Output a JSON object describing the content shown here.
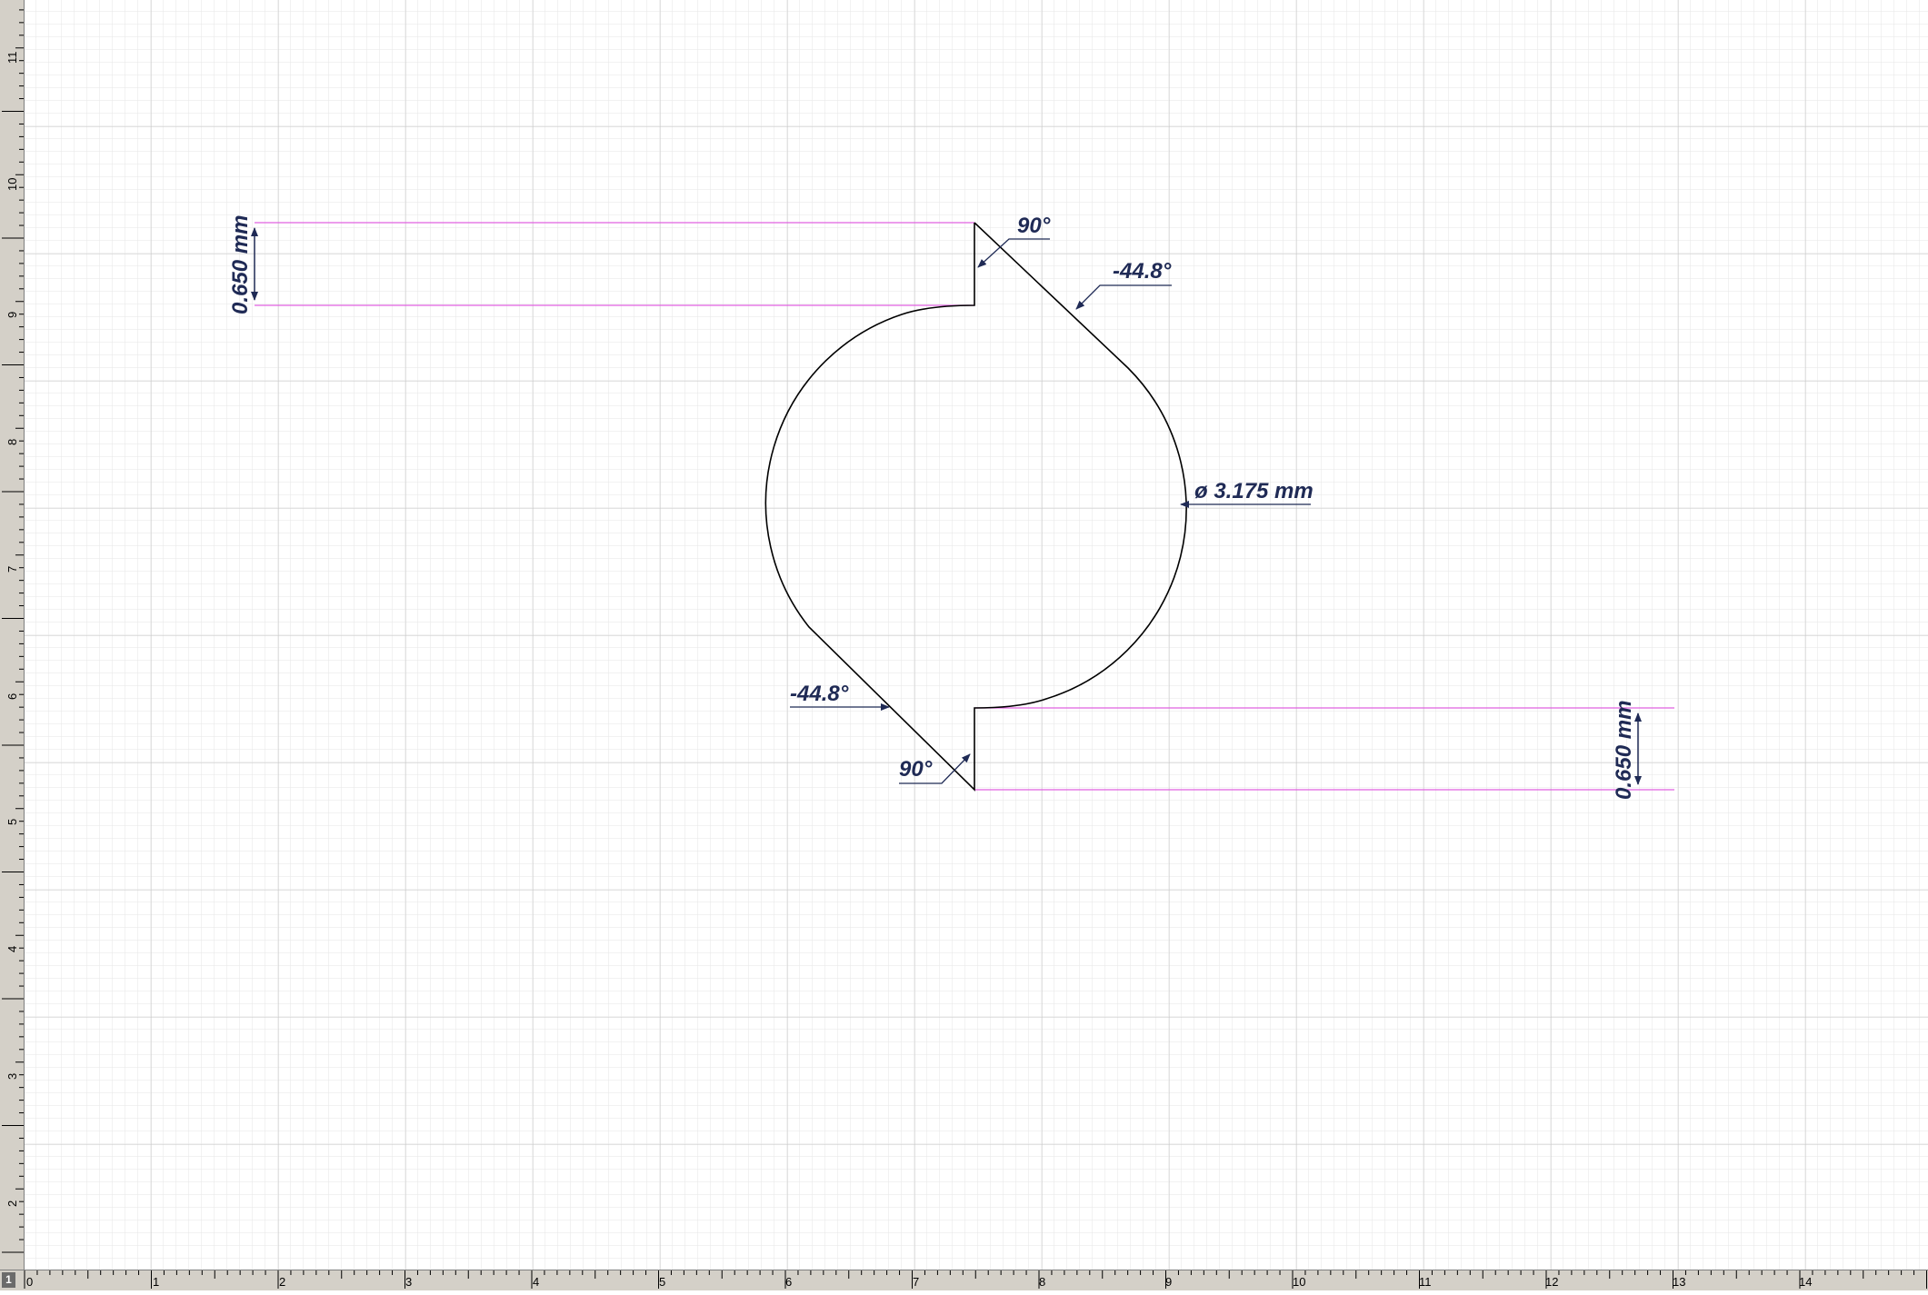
{
  "colors": {
    "grid_minor": "#e6e6e6",
    "grid_major": "#c7c7c7",
    "part_outline": "#000000",
    "extension_lines": "#e060e0",
    "dimension_text": "#1f2a55",
    "ruler_bg": "#d4d0c8"
  },
  "sheet_tab": {
    "label": "1"
  },
  "rulers": {
    "horizontal": [
      "0",
      "1",
      "2",
      "3",
      "4",
      "5",
      "6",
      "7",
      "8",
      "9",
      "10",
      "11",
      "12",
      "13",
      "14"
    ],
    "vertical": [
      "2",
      "3",
      "4",
      "5",
      "6",
      "7",
      "8",
      "9",
      "10",
      "11"
    ]
  },
  "dimensions": {
    "top_height": "0.650 mm",
    "bottom_height": "0.650 mm",
    "top_angle_90": "90°",
    "top_angle_chamfer": "-44.8°",
    "bottom_angle_90": "90°",
    "bottom_angle_chamfer": "-44.8°",
    "diameter": "ø 3.175 mm"
  }
}
